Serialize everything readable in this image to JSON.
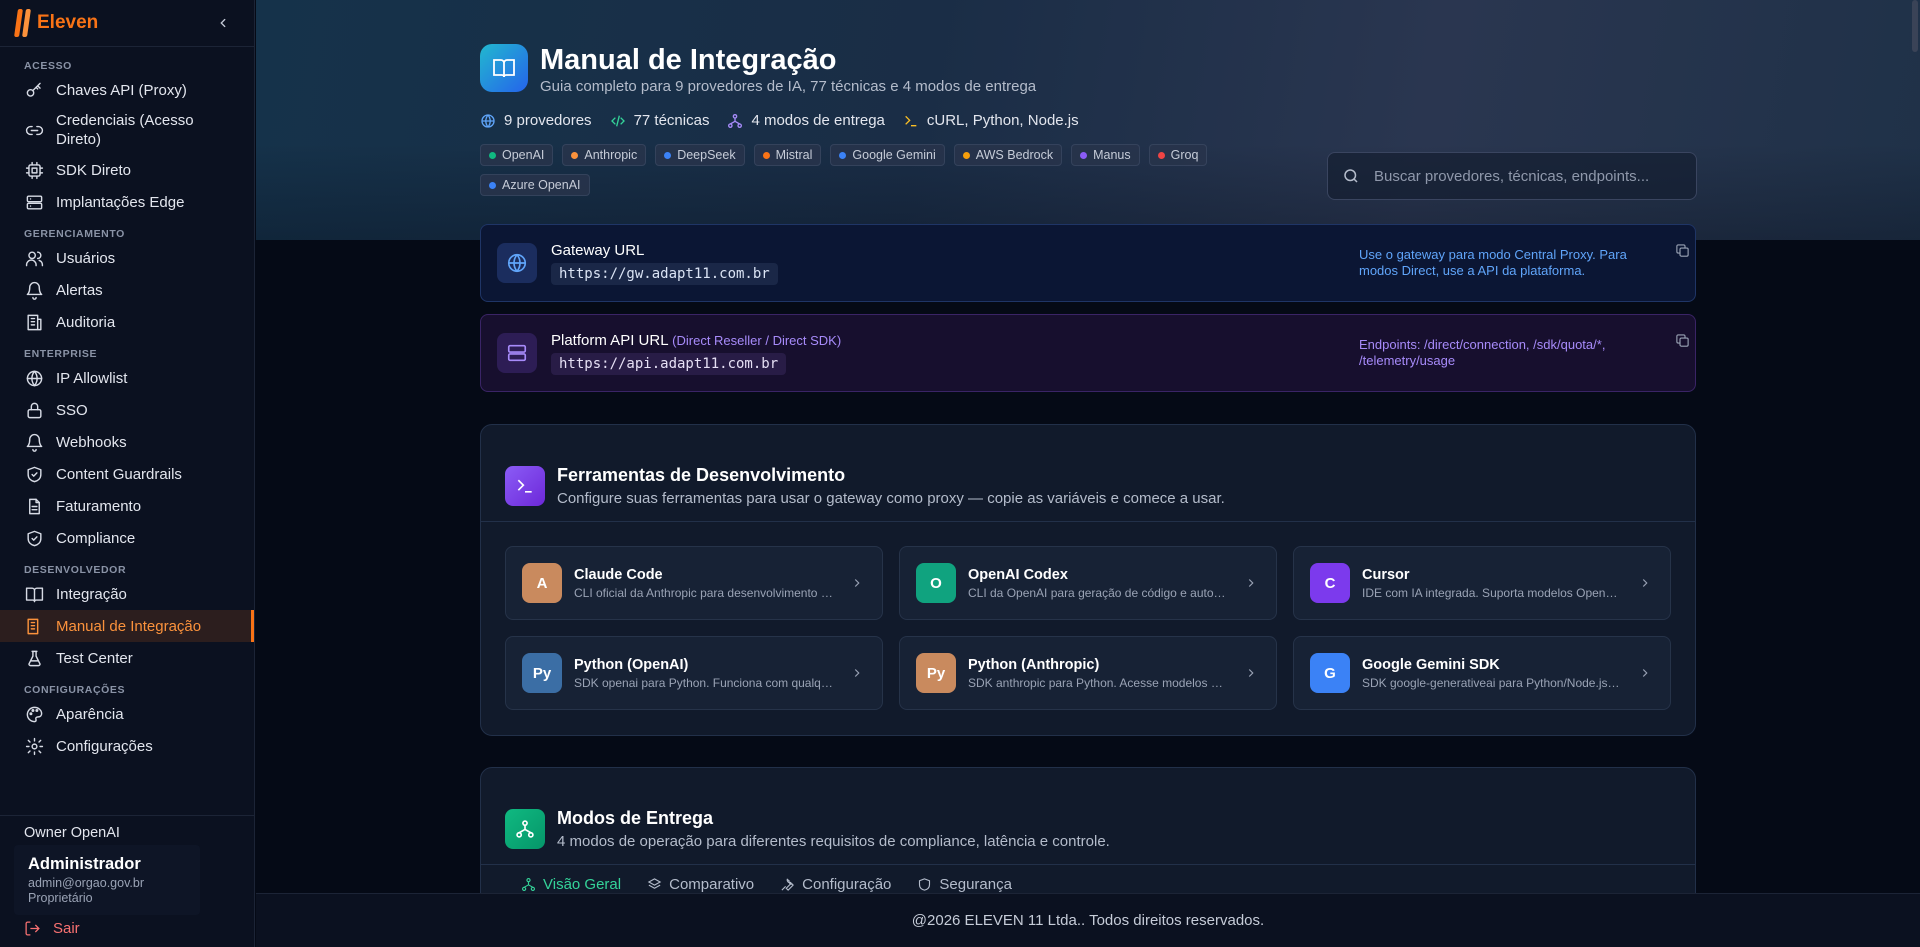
{
  "brand": {
    "name": "Eleven"
  },
  "sidebar": {
    "sections": [
      {
        "title": "ACESSO",
        "items": [
          {
            "label": "Chaves API (Proxy)",
            "icon": "key-icon"
          },
          {
            "label": "Credenciais (Acesso Direto)",
            "icon": "link-icon"
          },
          {
            "label": "SDK Direto",
            "icon": "chip-icon"
          },
          {
            "label": "Implantações Edge",
            "icon": "server-icon"
          }
        ]
      },
      {
        "title": "GERENCIAMENTO",
        "items": [
          {
            "label": "Usuários",
            "icon": "users-icon"
          },
          {
            "label": "Alertas",
            "icon": "bell-icon"
          },
          {
            "label": "Auditoria",
            "icon": "audit-icon"
          }
        ]
      },
      {
        "title": "ENTERPRISE",
        "items": [
          {
            "label": "IP Allowlist",
            "icon": "globe-icon"
          },
          {
            "label": "SSO",
            "icon": "lock-icon"
          },
          {
            "label": "Webhooks",
            "icon": "webhook-icon"
          },
          {
            "label": "Content Guardrails",
            "icon": "shield-icon"
          },
          {
            "label": "Faturamento",
            "icon": "file-icon"
          },
          {
            "label": "Compliance",
            "icon": "shield-check-icon"
          }
        ]
      },
      {
        "title": "DESENVOLVEDOR",
        "items": [
          {
            "label": "Integração",
            "icon": "book-icon"
          },
          {
            "label": "Manual de Integração",
            "icon": "book-open-icon"
          },
          {
            "label": "Test Center",
            "icon": "flask-icon"
          }
        ]
      },
      {
        "title": "CONFIGURAÇÕES",
        "items": [
          {
            "label": "Aparência",
            "icon": "palette-icon"
          },
          {
            "label": "Configurações",
            "icon": "gear-icon"
          }
        ]
      }
    ],
    "owner": "Owner OpenAI",
    "user": {
      "name": "Administrador",
      "email": "admin@orgao.gov.br",
      "role": "Proprietário"
    },
    "logout": "Sair"
  },
  "header": {
    "title": "Manual de Integração",
    "subtitle": "Guia completo para 9 provedores de IA, 77 técnicas e 4 modos de entrega",
    "stats": [
      "9 provedores",
      "77 técnicas",
      "4 modos de entrega",
      "cURL, Python, Node.js"
    ],
    "providers": [
      {
        "name": "OpenAI",
        "color": "#10b981"
      },
      {
        "name": "Anthropic",
        "color": "#fb923c"
      },
      {
        "name": "DeepSeek",
        "color": "#3b82f6"
      },
      {
        "name": "Mistral",
        "color": "#f97316"
      },
      {
        "name": "Google Gemini",
        "color": "#3b82f6"
      },
      {
        "name": "AWS Bedrock",
        "color": "#f59e0b"
      },
      {
        "name": "Manus",
        "color": "#8b5cf6"
      },
      {
        "name": "Groq",
        "color": "#ef4444"
      },
      {
        "name": "Azure OpenAI",
        "color": "#3b82f6"
      }
    ],
    "search_placeholder": "Buscar provedores, técnicas, endpoints..."
  },
  "gateway": {
    "label": "Gateway URL",
    "url": "https://gw.adapt11.com.br",
    "note": "Use o gateway para modo Central Proxy. Para modos Direct, use a API da plataforma."
  },
  "platform_api": {
    "label": "Platform API URL",
    "sublabel": "(Direct Reseller / Direct SDK)",
    "url": "https://api.adapt11.com.br",
    "note": "Endpoints: /direct/connection, /sdk/quota/*, /telemetry/usage"
  },
  "tools_panel": {
    "title": "Ferramentas de Desenvolvimento",
    "subtitle": "Configure suas ferramentas para usar o gateway como proxy — copie as variáveis e comece a usar.",
    "tools": [
      {
        "badge": "A",
        "name": "Claude Code",
        "desc": "CLI oficial da Anthropic para desenvolvimento assistido por IA",
        "color": "#c98a5e"
      },
      {
        "badge": "O",
        "name": "OpenAI Codex",
        "desc": "CLI da OpenAI para geração de código e automação",
        "color": "#10a37f"
      },
      {
        "badge": "C",
        "name": "Cursor",
        "desc": "IDE com IA integrada. Suporta modelos OpenAI e Anthropic",
        "color": "#7c3aed"
      },
      {
        "badge": "Py",
        "name": "Python (OpenAI)",
        "desc": "SDK openai para Python. Funciona com qualquer provedor",
        "color": "#3b6ea5"
      },
      {
        "badge": "Py",
        "name": "Python (Anthropic)",
        "desc": "SDK anthropic para Python. Acesse modelos Claude",
        "color": "#c98a5e"
      },
      {
        "badge": "G",
        "name": "Google Gemini SDK",
        "desc": "SDK google-generativeai para Python/Node.js com suporte",
        "color": "#3b82f6"
      }
    ]
  },
  "modes_panel": {
    "title": "Modos de Entrega",
    "subtitle": "4 modos de operação para diferentes requisitos de compliance, latência e controle.",
    "tabs": [
      "Visão Geral",
      "Comparativo",
      "Configuração",
      "Segurança"
    ]
  },
  "footer": {
    "text": "@2026 ELEVEN 11 Ltda.. Todos direitos reservados."
  },
  "colors": {
    "accent": "#f97316",
    "background": "#050a16",
    "sidebar": "#0b1120"
  }
}
